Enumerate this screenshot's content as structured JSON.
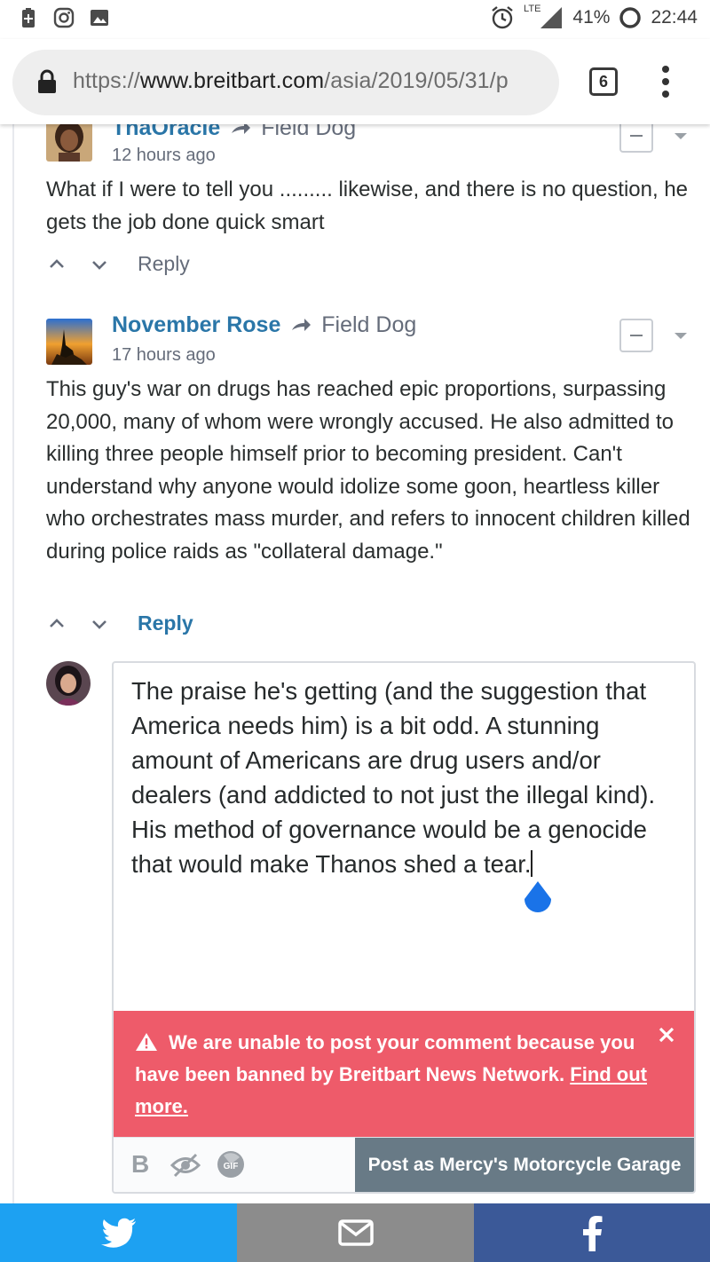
{
  "status_bar": {
    "network": "LTE",
    "battery": "41%",
    "time": "22:44",
    "icons": [
      "battery-saver-icon",
      "instagram-icon",
      "image-icon",
      "alarm-icon",
      "signal-icon",
      "battery-icon"
    ]
  },
  "browser": {
    "url_scheme": "https://",
    "url_host": "www.breitbart.com",
    "url_path": "/asia/2019/05/31/p",
    "tab_count": "6"
  },
  "comments": [
    {
      "author": "ThaOracle",
      "reply_to": "Field Dog",
      "time": "12 hours ago",
      "text": "What if I were to tell you ......... likewise, and there is no question, he gets the job done quick smart",
      "reply_label": "Reply"
    },
    {
      "author": "November Rose",
      "reply_to": "Field Dog",
      "time": "17 hours ago",
      "text": "This guy's war on drugs has reached epic proportions, surpassing 20,000, many of whom were wrongly accused. He also admitted to killing three people himself prior to becoming president. Can't understand why anyone would idolize some goon, heartless killer who orchestrates mass murder, and refers to innocent children killed during police raids as \"collateral damage.\"",
      "reply_label": "Reply"
    }
  ],
  "composer": {
    "text": "The praise he's getting (and the suggestion that America needs him) is a bit odd. A stunning amount of Americans are drug users and/or dealers (and addicted to not just the illegal kind). His method of governance would be a genocide that would make Thanos shed a tear.",
    "error_message": "We are unable to post your comment because you have been banned by Breitbart News Network.",
    "error_link": "Find out more.",
    "bold_label": "B",
    "gif_label": "GIF",
    "post_button": "Post as Mercy's Motorcycle Garage"
  },
  "colors": {
    "link_blue": "#2a76a8",
    "error_red": "#ee5b6a",
    "post_button": "#687a86",
    "twitter": "#1da1f2",
    "email": "#8c8c8c",
    "facebook": "#3b5998"
  },
  "share_bar": [
    "twitter-icon",
    "email-icon",
    "facebook-icon"
  ]
}
